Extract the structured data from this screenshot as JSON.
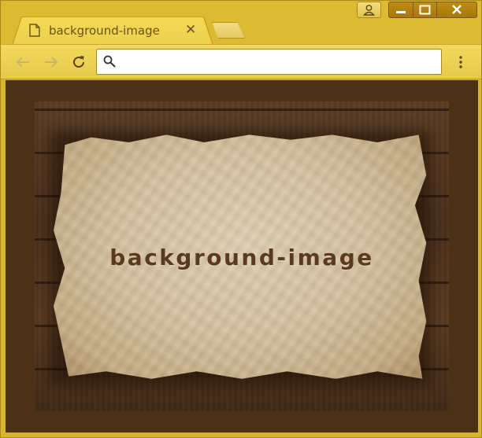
{
  "window": {
    "tab": {
      "title": "background-image",
      "close": "✕"
    },
    "controls": {
      "minimize": "–",
      "maximize": "☐",
      "close": "✕"
    }
  },
  "toolbar": {
    "address": {
      "value": "",
      "placeholder": ""
    }
  },
  "page": {
    "heading": "background-image"
  },
  "colors": {
    "frame": "#d7b52c",
    "tab": "#ecd04c",
    "window_controls": "#b08010",
    "page_background": "#4b3217",
    "heading_text": "#5a3b1f"
  },
  "icons": [
    "page-icon",
    "profile-icon",
    "back-icon",
    "forward-icon",
    "reload-icon",
    "search-icon",
    "menu-icon"
  ]
}
